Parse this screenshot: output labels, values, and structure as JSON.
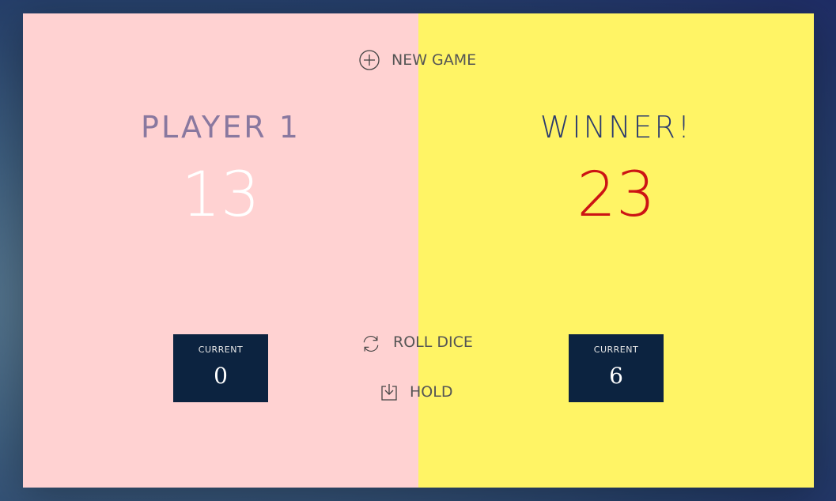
{
  "players": [
    {
      "name": "PLAYER 1",
      "score": "13",
      "current_label": "CURRENT",
      "current_score": "0"
    },
    {
      "name": "WINNER!",
      "score": "23",
      "current_label": "CURRENT",
      "current_score": "6"
    }
  ],
  "buttons": {
    "new_game": "NEW GAME",
    "roll_dice": "ROLL DICE",
    "hold": "HOLD"
  },
  "icons": {
    "new_game": "plus-circle-icon",
    "roll_dice": "refresh-icon",
    "hold": "download-icon"
  },
  "colors": {
    "player1_panel": "#ffd2d2",
    "player2_panel": "#fff465",
    "current_box": "#0c2340",
    "winner_score": "#cc1414"
  }
}
